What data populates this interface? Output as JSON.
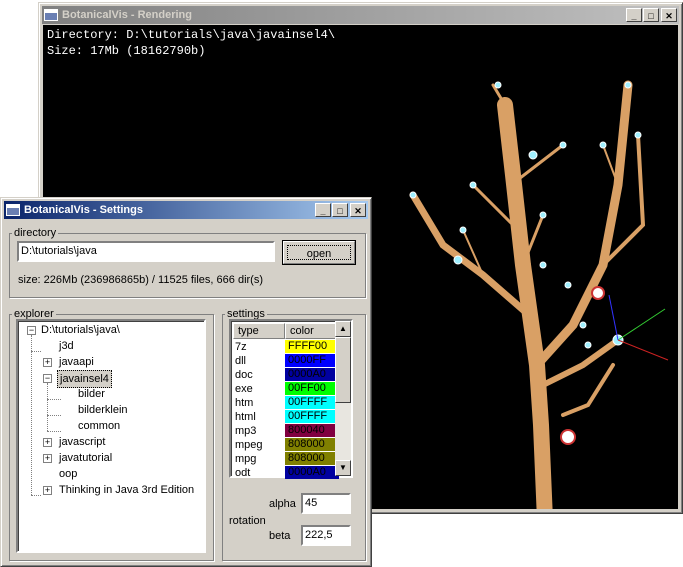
{
  "render_window": {
    "title": "BotanicalVis - Rendering",
    "directory_line": "Directory: D:\\tutorials\\java\\javainsel4\\",
    "size_line": "Size: 17Mb (18162790b)"
  },
  "settings_window": {
    "title": "BotanicalVis - Settings",
    "directory": {
      "legend": "directory",
      "path_value": "D:\\tutorials\\java",
      "open_label": "open",
      "size_info": "size: 226Mb (236986865b) / 11525 files, 666 dir(s)"
    },
    "explorer": {
      "legend": "explorer",
      "nodes": [
        {
          "label": "D:\\tutorials\\java\\",
          "toggle": "−"
        },
        {
          "label": "j3d",
          "toggle": ""
        },
        {
          "label": "javaapi",
          "toggle": "+"
        },
        {
          "label": "javainsel4",
          "toggle": "−"
        },
        {
          "label": "bilder",
          "toggle": ""
        },
        {
          "label": "bilderklein",
          "toggle": ""
        },
        {
          "label": "common",
          "toggle": ""
        },
        {
          "label": "javascript",
          "toggle": "+"
        },
        {
          "label": "javatutorial",
          "toggle": "+"
        },
        {
          "label": "oop",
          "toggle": ""
        },
        {
          "label": "Thinking in Java 3rd Edition",
          "toggle": "+"
        }
      ]
    },
    "settings": {
      "legend": "settings",
      "columns": [
        "type",
        "color"
      ],
      "rows": [
        {
          "type": "7z",
          "color": "FFFF00",
          "bg": "#ffff00",
          "fg": "#000000"
        },
        {
          "type": "dll",
          "color": "0000FF",
          "bg": "#0000ff",
          "fg": "#000000"
        },
        {
          "type": "doc",
          "color": "0000A0",
          "bg": "#0000a0",
          "fg": "#000000"
        },
        {
          "type": "exe",
          "color": "00FF00",
          "bg": "#00ff00",
          "fg": "#000000"
        },
        {
          "type": "htm",
          "color": "00FFFF",
          "bg": "#00ffff",
          "fg": "#000000"
        },
        {
          "type": "html",
          "color": "00FFFF",
          "bg": "#00ffff",
          "fg": "#000000"
        },
        {
          "type": "mp3",
          "color": "800040",
          "bg": "#800040",
          "fg": "#000000"
        },
        {
          "type": "mpeg",
          "color": "808000",
          "bg": "#808000",
          "fg": "#000000"
        },
        {
          "type": "mpg",
          "color": "808000",
          "bg": "#808000",
          "fg": "#000000"
        },
        {
          "type": "odt",
          "color": "0000A0",
          "bg": "#0000a0",
          "fg": "#000000"
        }
      ],
      "rotation_label": "rotation",
      "alpha_label": "alpha",
      "alpha_value": "45",
      "beta_label": "beta",
      "beta_value": "222,5"
    }
  }
}
